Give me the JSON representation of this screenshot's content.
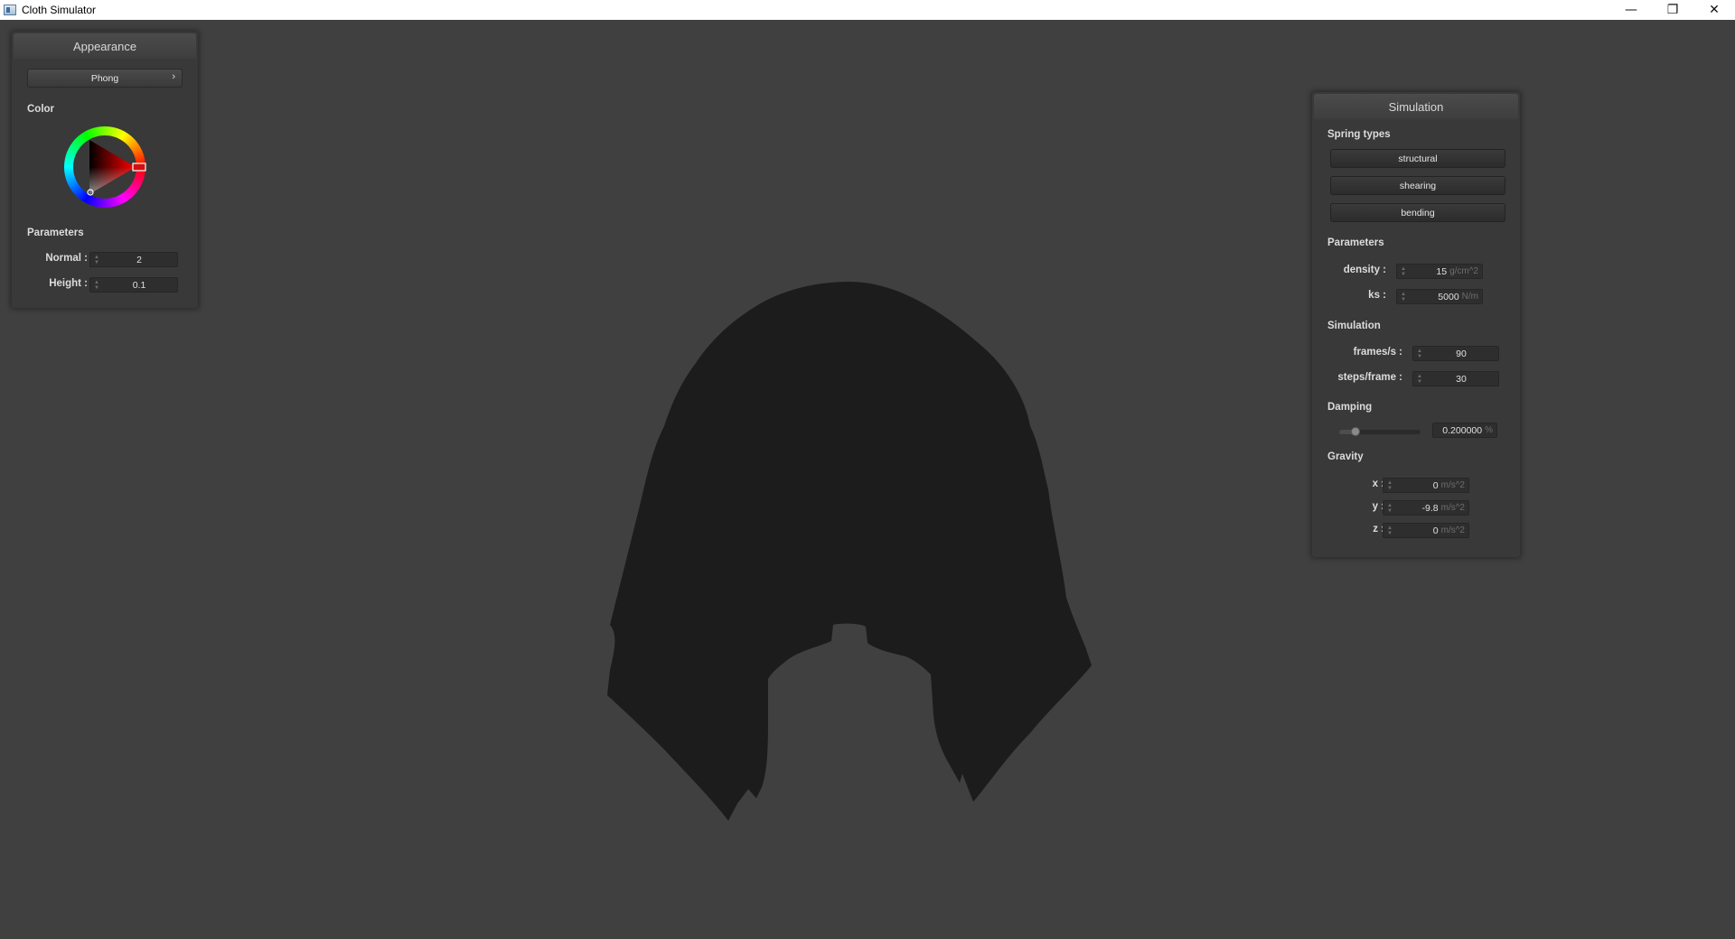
{
  "window": {
    "title": "Cloth Simulator",
    "minimize_glyph": "—",
    "restore_glyph": "❐",
    "close_glyph": "✕"
  },
  "colors": {
    "background": "#404040",
    "cloth": "#1c1c1c",
    "panel": "#393939",
    "selected_color": "#c01818"
  },
  "appearance": {
    "title": "Appearance",
    "shading_mode": "Phong",
    "color_label": "Color",
    "parameters_label": "Parameters",
    "normal_label": "Normal :",
    "normal_value": "2",
    "height_label": "Height :",
    "height_value": "0.1"
  },
  "simulation": {
    "title": "Simulation",
    "spring_types_label": "Spring types",
    "spring_types": [
      "structural",
      "shearing",
      "bending"
    ],
    "parameters_label": "Parameters",
    "density_label": "density :",
    "density_value": "15",
    "density_unit": "g/cm^2",
    "ks_label": "ks :",
    "ks_value": "5000",
    "ks_unit": "N/m",
    "simulation_label": "Simulation",
    "fps_label": "frames/s :",
    "fps_value": "90",
    "steps_label": "steps/frame :",
    "steps_value": "30",
    "damping_label": "Damping",
    "damping_value": "0.200000",
    "damping_unit": "%",
    "damping_fraction": 0.2,
    "gravity_label": "Gravity",
    "gravity_x_label": "x :",
    "gravity_x_value": "0",
    "gravity_y_label": "y :",
    "gravity_y_value": "-9.8",
    "gravity_z_label": "z :",
    "gravity_z_value": "0",
    "gravity_unit": "m/s^2"
  }
}
